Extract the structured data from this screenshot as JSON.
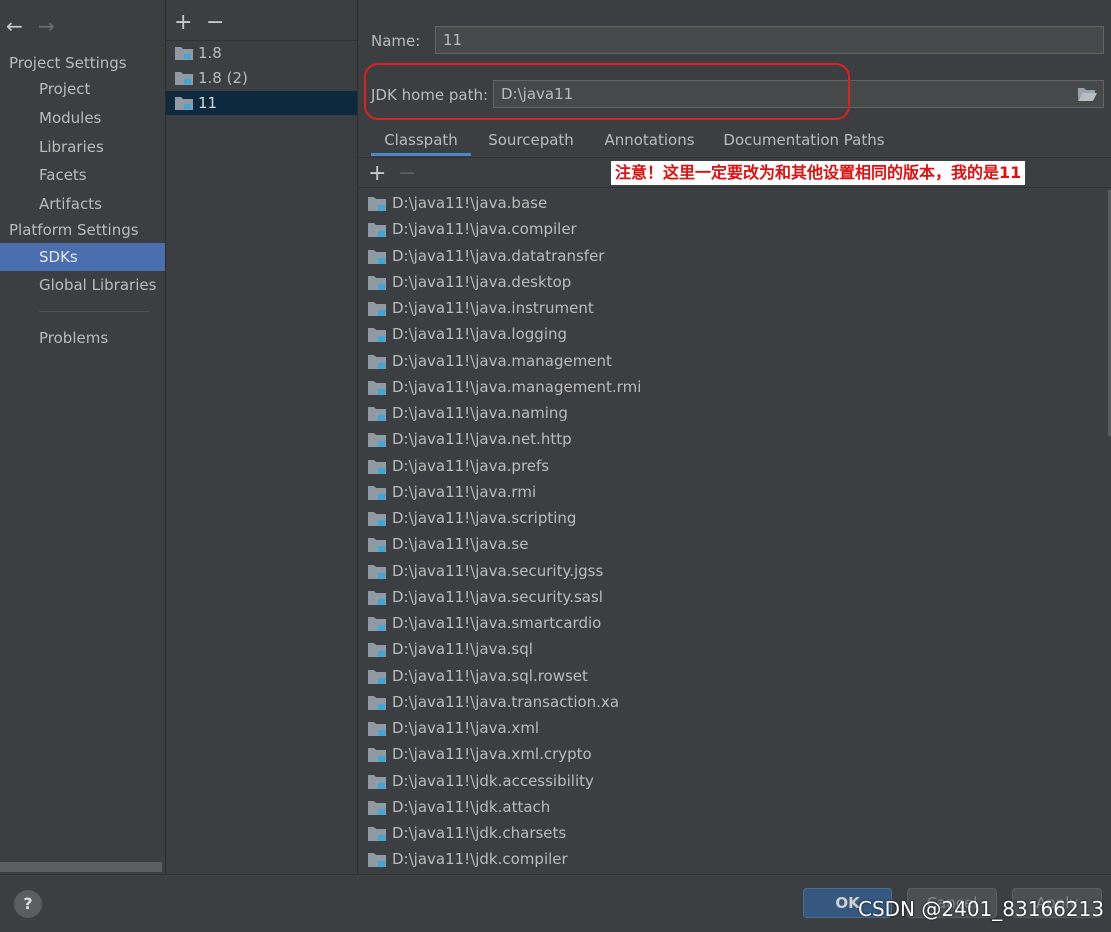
{
  "nav": {
    "back_icon": "arrow-left-icon",
    "forward_icon": "arrow-right-icon"
  },
  "sidebar": {
    "project_settings_header": "Project Settings",
    "project_items": [
      "Project",
      "Modules",
      "Libraries",
      "Facets",
      "Artifacts"
    ],
    "platform_settings_header": "Platform Settings",
    "platform_items": [
      "SDKs",
      "Global Libraries"
    ],
    "selected": "SDKs",
    "problems": "Problems"
  },
  "sdk_list": {
    "add_label": "+",
    "remove_label": "−",
    "items": [
      "1.8",
      "1.8 (2)",
      "11"
    ],
    "selected": "11",
    "icon": "jdk-folder-icon"
  },
  "details": {
    "name_label": "Name:",
    "name_value": "11",
    "jdk_home_label": "JDK home path:",
    "jdk_home_value": "D:\\java11",
    "browse_icon": "folder-open-icon"
  },
  "tabs": [
    "Classpath",
    "Sourcepath",
    "Annotations",
    "Documentation Paths"
  ],
  "active_tab": "Classpath",
  "classpath_toolbar": {
    "add": "+",
    "remove": "−"
  },
  "annotation_text": "注意！这里一定要改为和其他设置相同的版本，我的是11",
  "classpath_items": [
    "D:\\java11!\\java.base",
    "D:\\java11!\\java.compiler",
    "D:\\java11!\\java.datatransfer",
    "D:\\java11!\\java.desktop",
    "D:\\java11!\\java.instrument",
    "D:\\java11!\\java.logging",
    "D:\\java11!\\java.management",
    "D:\\java11!\\java.management.rmi",
    "D:\\java11!\\java.naming",
    "D:\\java11!\\java.net.http",
    "D:\\java11!\\java.prefs",
    "D:\\java11!\\java.rmi",
    "D:\\java11!\\java.scripting",
    "D:\\java11!\\java.se",
    "D:\\java11!\\java.security.jgss",
    "D:\\java11!\\java.security.sasl",
    "D:\\java11!\\java.smartcardio",
    "D:\\java11!\\java.sql",
    "D:\\java11!\\java.sql.rowset",
    "D:\\java11!\\java.transaction.xa",
    "D:\\java11!\\java.xml",
    "D:\\java11!\\java.xml.crypto",
    "D:\\java11!\\jdk.accessibility",
    "D:\\java11!\\jdk.attach",
    "D:\\java11!\\jdk.charsets",
    "D:\\java11!\\jdk.compiler"
  ],
  "footer": {
    "help_label": "?",
    "ok_label": "OK",
    "cancel_label": "Cancel",
    "apply_label": "Apply",
    "watermark": "CSDN @2401_83166213"
  },
  "colors": {
    "accent": "#4b6eaf",
    "selection": "#0d293e",
    "highlight": "#e02020",
    "background": "#3c3f41"
  }
}
